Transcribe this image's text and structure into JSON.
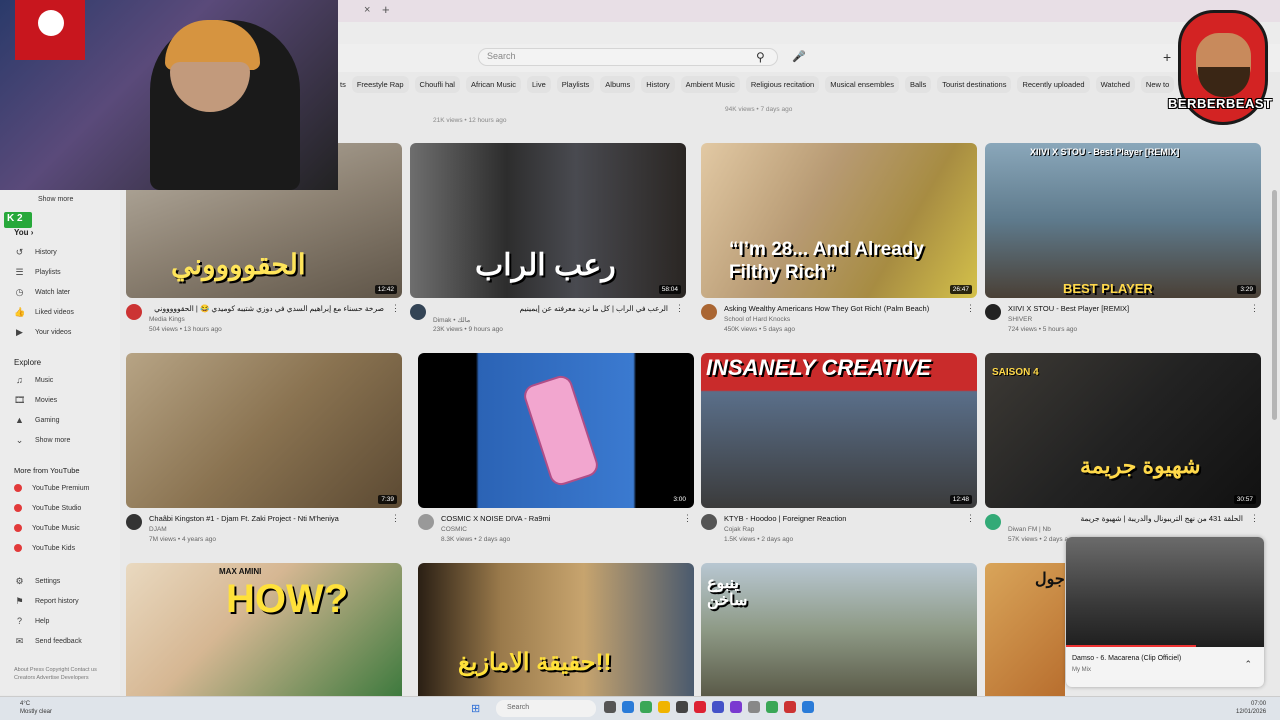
{
  "browser": {
    "tab_close": "×",
    "tab_new": "+"
  },
  "header": {
    "search_placeholder": "Search",
    "search_icon": "search-icon",
    "mic_icon": "mic-icon",
    "create_icon": "plus-icon"
  },
  "chips": [
    "ts",
    "Freestyle Rap",
    "Choufli hal",
    "African Music",
    "Live",
    "Playlists",
    "Albums",
    "History",
    "Ambient Music",
    "Religious recitation",
    "Musical ensembles",
    "Balls",
    "Tourist destinations",
    "Recently uploaded",
    "Watched",
    "New to"
  ],
  "overlay": {
    "webcam_label": "K 2",
    "logo_text": "BERBERBEAST"
  },
  "top_row": [
    {
      "stats": "21K views • 12 hours ago"
    },
    {
      "stats": "94K views • 7 days ago"
    },
    {
      "stats": ""
    }
  ],
  "sidebar": {
    "show_more_top": "Show more",
    "you_label": "You",
    "you_items": [
      {
        "label": "History",
        "icon": "history-icon"
      },
      {
        "label": "Playlists",
        "icon": "playlist-icon"
      },
      {
        "label": "Watch later",
        "icon": "clock-icon"
      },
      {
        "label": "Liked videos",
        "icon": "like-icon"
      },
      {
        "label": "Your videos",
        "icon": "video-icon"
      }
    ],
    "explore_label": "Explore",
    "explore_items": [
      {
        "label": "Music",
        "icon": "music-icon"
      },
      {
        "label": "Movies",
        "icon": "film-icon"
      },
      {
        "label": "Gaming",
        "icon": "gamepad-icon"
      },
      {
        "label": "Show more",
        "icon": "chevron-down-icon"
      }
    ],
    "more_label": "More from YouTube",
    "more_items": [
      "YouTube Premium",
      "YouTube Studio",
      "YouTube Music",
      "YouTube Kids"
    ],
    "settings_items": [
      {
        "label": "Settings",
        "icon": "gear-icon"
      },
      {
        "label": "Report history",
        "icon": "flag-icon"
      },
      {
        "label": "Help",
        "icon": "help-icon"
      },
      {
        "label": "Send feedback",
        "icon": "feedback-icon"
      }
    ],
    "footer": "About Press Copyright Contact us Creators Advertise Developers"
  },
  "videos": [
    {
      "title": "صرخة حسناء مع إبراهيم السدي في دوزي شتيبه كوميدي 😂 | الحقوووووني",
      "channel": "Media Kings",
      "stats": "504 views • 13 hours ago",
      "duration": "12:42",
      "thumb_text": "الحقووووني"
    },
    {
      "title": "الرعب في الراب | كل ما تريد معرفته عن إيمينيم",
      "channel": "Dimak • مالك",
      "stats": "23K views • 9 hours ago",
      "duration": "58:04",
      "thumb_text": "رعب الراب"
    },
    {
      "title": "Asking Wealthy Americans How They Got Rich! (Palm Beach)",
      "channel": "School of Hard Knocks",
      "stats": "450K views • 5 days ago",
      "duration": "26:47",
      "thumb_text": "“I’m 28... And Already Filthy Rich”"
    },
    {
      "title": "XIIVI X STOU - Best Player [REMIX]",
      "channel": "SHIVER",
      "stats": "724 views • 5 hours ago",
      "duration": "3:29",
      "thumb_text": "BEST PLAYER",
      "thumb_top": "XIIVI X STOU - Best Player [REMIX]"
    },
    {
      "title": "Chaâbi Kingston #1 - Djam Ft. Zaki Project - Nti M'heniya",
      "channel": "DJAM",
      "stats": "7M views • 4 years ago",
      "duration": "7:39",
      "thumb_text": ""
    },
    {
      "title": "COSMIC X NOISE DIVA - Ra9mi",
      "channel": "COSMIC",
      "stats": "8.3K views • 2 days ago",
      "duration": "3:00",
      "thumb_text": ""
    },
    {
      "title": "KTYB - Hoodoo | Foreigner Reaction",
      "channel": "Cojak Rap",
      "stats": "1.5K views • 2 days ago",
      "duration": "12:48",
      "thumb_text": "INSANELY CREATIVE"
    },
    {
      "title": "الحلقة 431 من نهج التريبونال والدريبة | شهيوة جريمة",
      "channel": "Diwan FM | Nb",
      "stats": "57K views • 2 days ago",
      "duration": "30:57",
      "thumb_text": "شهيوة جريمة",
      "thumb_top": "SAISON 4"
    },
    {
      "title": "",
      "channel": "",
      "stats": "",
      "duration": "",
      "thumb_text": "HOW?",
      "thumb_top": "MAX AMINI"
    },
    {
      "title": "",
      "channel": "",
      "stats": "",
      "duration": "",
      "thumb_text": "حقيقة الامازيغ!!"
    },
    {
      "title": "",
      "channel": "",
      "stats": "",
      "duration": "",
      "thumb_text": "ينبوع ساخن"
    },
    {
      "title": "",
      "channel": "",
      "stats": "",
      "duration": "",
      "thumb_text": "جول"
    }
  ],
  "miniplayer": {
    "title": "Damso - 6. Macarena (Clip Officiel)",
    "subtitle": "My Mix"
  },
  "taskbar": {
    "search": "Search",
    "weather_temp": "4°C",
    "weather_desc": "Mostly clear",
    "time": "07:00",
    "date": "12/01/2026"
  }
}
